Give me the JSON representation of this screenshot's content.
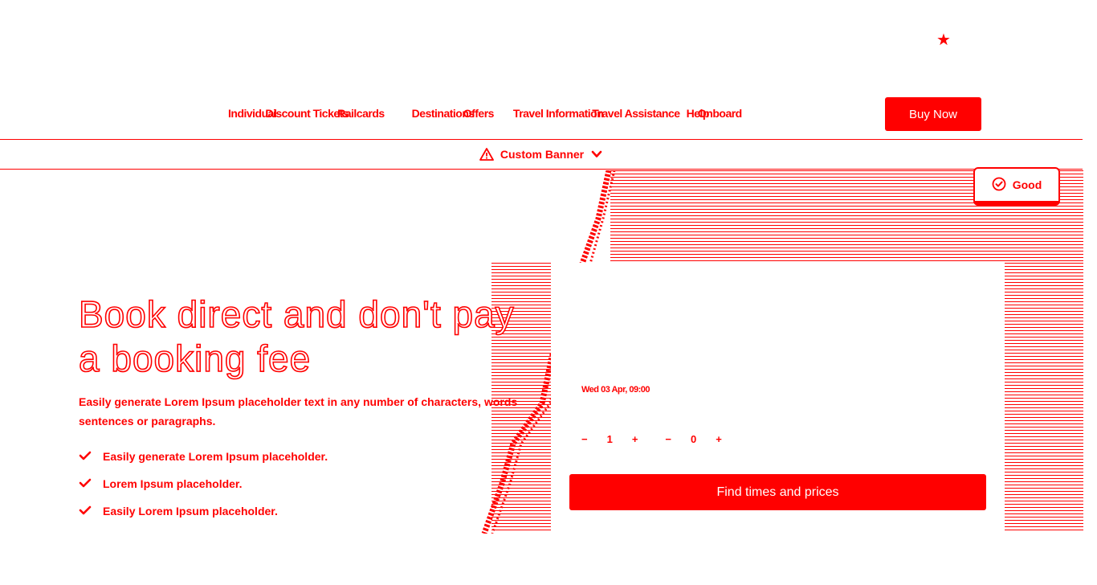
{
  "header": {
    "favorite_icon": "star-icon"
  },
  "nav": {
    "group_left": [
      "Individual",
      "Discount Tickets",
      "Railcards"
    ],
    "group_mid": [
      "Destinations",
      "Offers"
    ],
    "group_right": [
      "Travel Information",
      "Travel Assistance",
      "Help",
      "Onboard"
    ]
  },
  "buy_button": "Buy Now",
  "banner": {
    "label": "Custom Banner",
    "warning_icon": "warning-icon",
    "chevron_icon": "chevron-down-icon"
  },
  "status_badge": {
    "label": "Good",
    "icon": "check-circle-icon"
  },
  "hero": {
    "title": "Book direct and don't pay a booking fee",
    "subtitle": "Easily generate Lorem Ipsum placeholder text in any number of characters, words sentences or paragraphs.",
    "checklist": [
      "Easily generate Lorem Ipsum placeholder.",
      "Lorem Ipsum placeholder.",
      "Easily Lorem Ipsum placeholder."
    ]
  },
  "booking": {
    "when_value": "Wed 03 Apr, 09:00",
    "adults": {
      "minus": "−",
      "value": "1",
      "plus": "+"
    },
    "children": {
      "minus": "−",
      "value": "0",
      "plus": "+"
    },
    "find_button": "Find times and prices"
  },
  "colors": {
    "accent": "#ff0000",
    "background": "#ffffff"
  }
}
